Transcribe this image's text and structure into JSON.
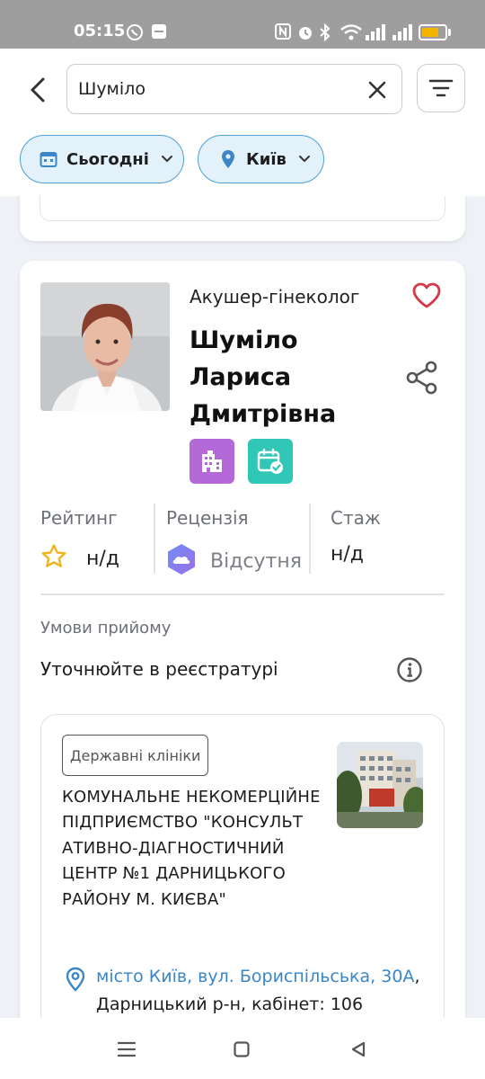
{
  "status_bar": {
    "time": "05:15",
    "battery_level": 0.75,
    "battery_color": "#f5b400"
  },
  "search": {
    "value": "Шуміло",
    "placeholder": ""
  },
  "filters": [
    {
      "label": "Сьогодні",
      "icon": "calendar-icon"
    },
    {
      "label": "Київ",
      "icon": "location-pin-icon"
    }
  ],
  "doctor": {
    "specialty": "Акушер-гінеколог",
    "name_lines": [
      "Шуміло",
      "Лариса",
      "Дмитрівна"
    ],
    "badges": [
      {
        "icon": "building-icon",
        "color": "#b36ad8"
      },
      {
        "icon": "calendar-check-icon",
        "color": "#31c7b6"
      }
    ],
    "stats": [
      {
        "label": "Рейтинг",
        "value": "н/д",
        "icon": "star-icon"
      },
      {
        "label": "Рецензія",
        "value": "Відсутня",
        "icon": "cloud-hexagon-icon"
      },
      {
        "label": "Стаж",
        "value": "н/д"
      }
    ],
    "conditions_label": "Умови прийому",
    "conditions_value": "Уточнюйте в реєстратурі"
  },
  "clinic": {
    "type": "Державні клініки",
    "name": "КОМУНАЛЬНЕ НЕКОМЕРЦІЙНЕ ПІДПРИЄМСТВО \"КОНСУЛЬТ АТИВНО-ДІАГНОСТИЧНИЙ ЦЕНТР №1 ДАРНИЦЬКОГО РАЙОНУ М. КИЄВА\"",
    "address_link": "місто Київ, вул. Бориспільська, 30А",
    "address_rest": ", Дарницький р-н, кабінет: 106"
  },
  "colors": {
    "accent": "#3a86c7",
    "favorite": "#d23a4a",
    "chip_border": "#4f9fd6",
    "chip_bg": "#e3f1fb"
  }
}
